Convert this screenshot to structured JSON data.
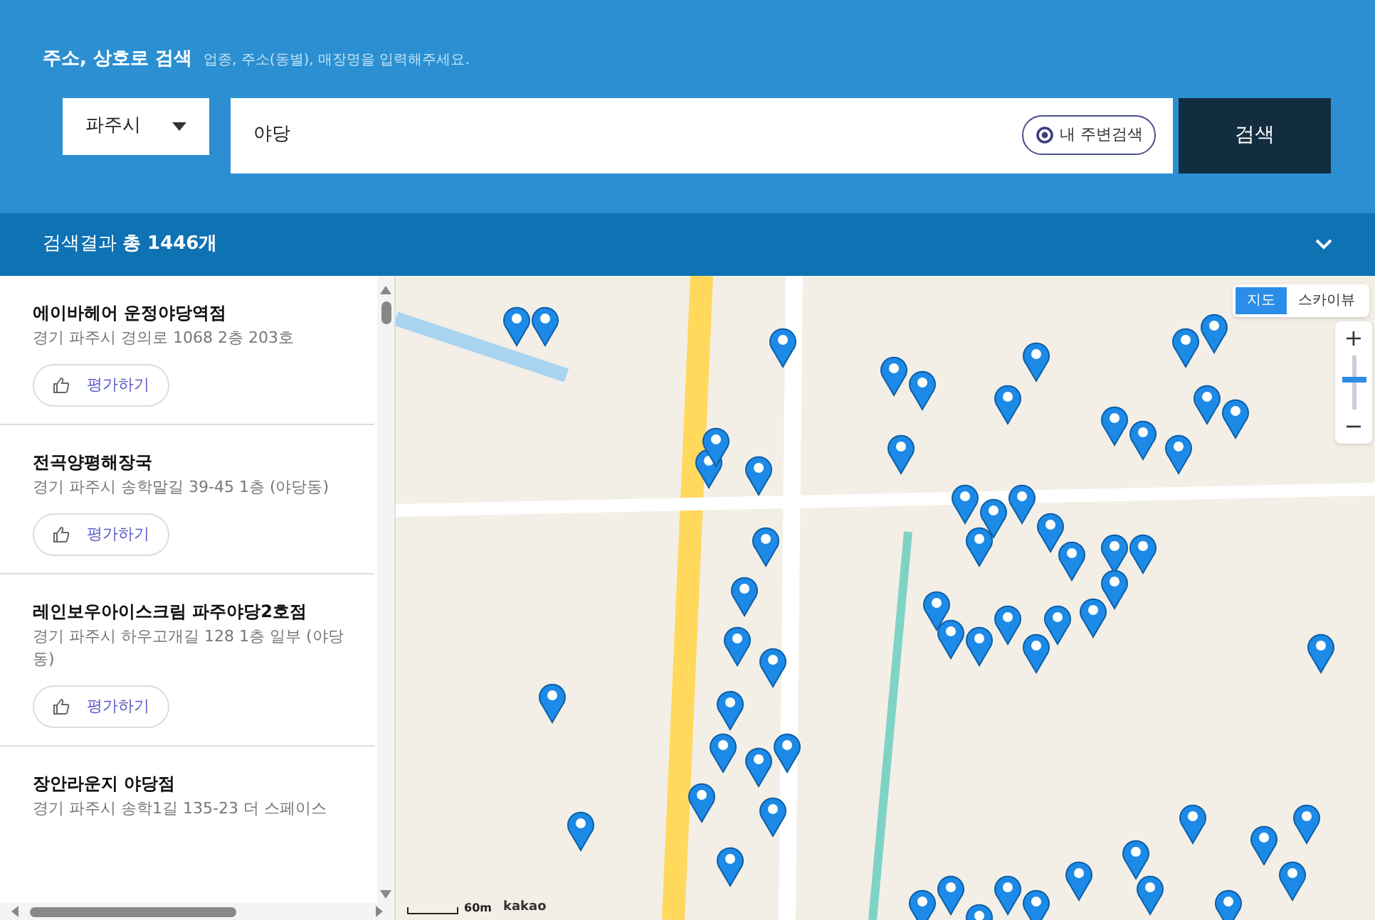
{
  "search_header": {
    "title": "주소, 상호로 검색",
    "hint": "업종, 주소(동별), 매장명을 입력해주세요.",
    "region_select": "파주시",
    "query": "야당",
    "nearby_button": "내 주변검색",
    "search_button": "검색"
  },
  "results_bar": {
    "label": "검색결과",
    "count": "총 1446개",
    "expanded": false
  },
  "results": [
    {
      "name": "에이바헤어 운정야당역점",
      "address": "경기 파주시 경의로 1068 2층 203호",
      "rate_button": "평가하기"
    },
    {
      "name": "전곡양평해장국",
      "address": "경기 파주시 송학말길 39-45 1층 (야당동)",
      "rate_button": "평가하기"
    },
    {
      "name": "레인보우아이스크림 파주야당2호점",
      "address": "경기 파주시 하우고개길 128 1층 일부 (야당동)",
      "rate_button": "평가하기"
    },
    {
      "name": "장안라운지 야당점",
      "address": "경기 파주시 송학1길 135-23 더 스페이스"
    }
  ],
  "map": {
    "view_types": [
      {
        "label": "지도",
        "selected": true
      },
      {
        "label": "스카이뷰",
        "selected": false
      }
    ],
    "zoom": {
      "in": "+",
      "out": "−",
      "level": 0.55
    },
    "scale": "60m",
    "brand": "kakao"
  }
}
